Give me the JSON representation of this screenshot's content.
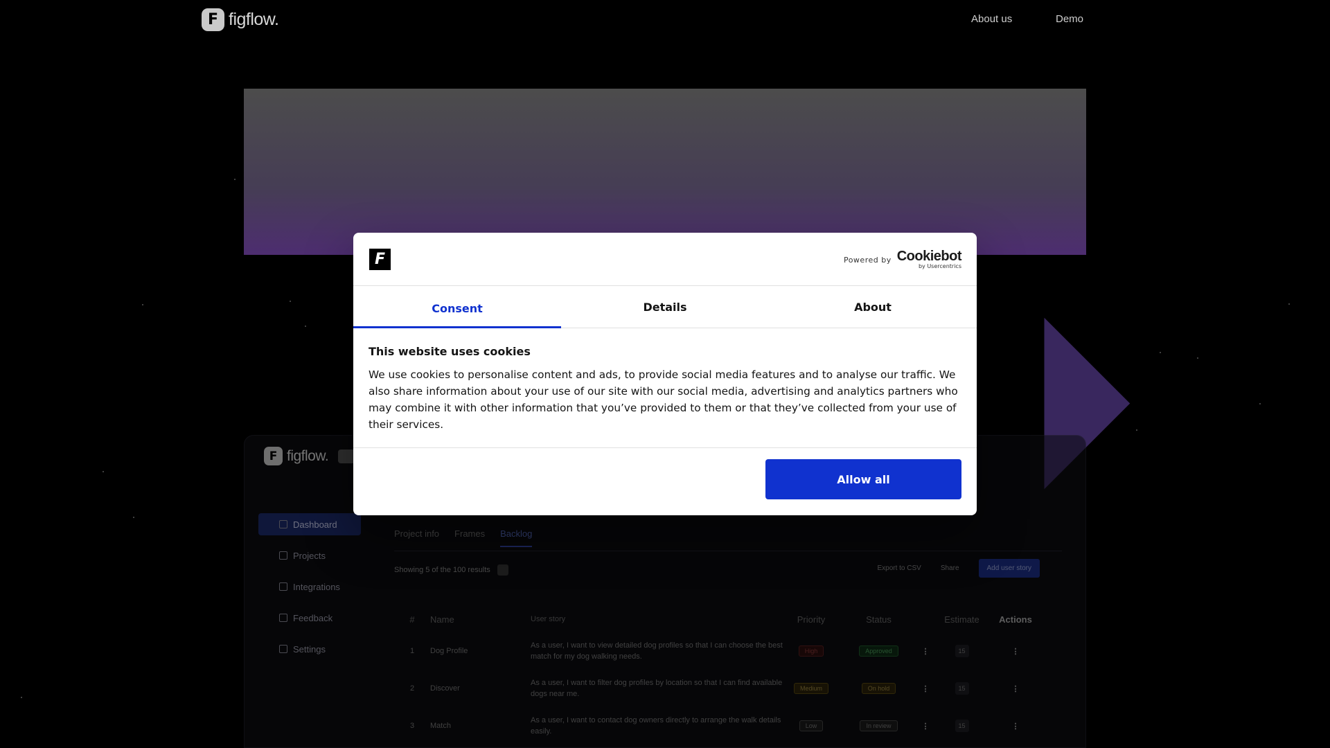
{
  "brand": {
    "logo_letter": "F",
    "name": "figflow."
  },
  "nav": {
    "about": "About us",
    "demo": "Demo"
  },
  "dashboard": {
    "sidebar": [
      "Dashboard",
      "Projects",
      "Integrations",
      "Feedback",
      "Settings"
    ],
    "tabs": [
      "Project info",
      "Frames",
      "Backlog"
    ],
    "showing": "Showing 5 of the 100 results",
    "toolbar": {
      "export": "Export to CSV",
      "share": "Share",
      "add": "Add user story"
    },
    "columns": {
      "num": "#",
      "name": "Name",
      "story": "User story",
      "priority": "Priority",
      "status": "Status",
      "estimate": "Estimate",
      "actions": "Actions"
    },
    "rows": [
      {
        "num": "1",
        "name": "Dog Profile",
        "story": "As a user, I want to view detailed dog profiles so that I can choose the best match for my dog walking needs.",
        "priority": "High",
        "status": "Approved",
        "estimate": "15"
      },
      {
        "num": "2",
        "name": "Discover",
        "story": "As a user, I want to filter dog profiles by location so that I can find available dogs near me.",
        "priority": "Medium",
        "status": "On hold",
        "estimate": "15"
      },
      {
        "num": "3",
        "name": "Match",
        "story": "As a user, I want to contact dog owners directly to arrange the walk details easily.",
        "priority": "Low",
        "status": "In review",
        "estimate": "15"
      }
    ]
  },
  "cookie": {
    "logo_letter": "F",
    "powered_by": "Powered by",
    "provider": "Cookiebot",
    "provider_sub": "by Usercentrics",
    "tabs": {
      "consent": "Consent",
      "details": "Details",
      "about": "About"
    },
    "title": "This website uses cookies",
    "text": "We use cookies to personalise content and ads, to provide social media features and to analyse our traffic. We also share information about your use of our site with our social media, advertising and analytics partners who may combine it with other information that you’ve provided to them or that they’ve collected from your use of their services.",
    "allow_all": "Allow all"
  },
  "colors": {
    "accent": "#1032cf",
    "background": "#000000",
    "dialog": "#ffffff"
  }
}
